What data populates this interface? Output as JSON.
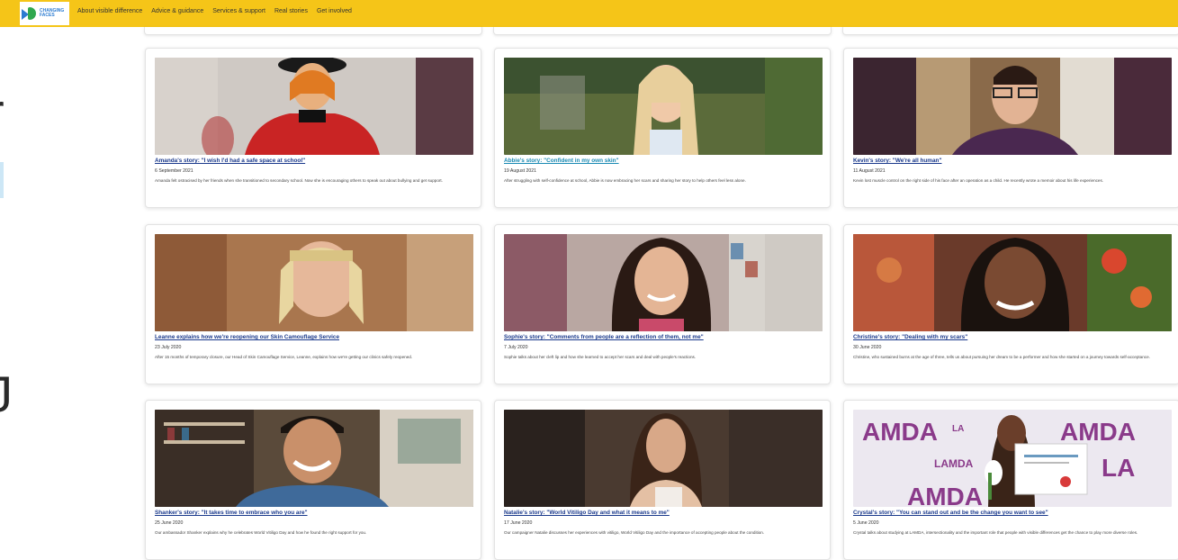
{
  "brand": {
    "logo_text": "CHANGING FACES"
  },
  "nav": [
    "About visible difference",
    "Advice & guidance",
    "Services & support",
    "Real stories",
    "Get involved"
  ],
  "colors": {
    "header": "#f5c518",
    "title_link": "#1b3a8c",
    "visited_link": "#1a8ab3"
  },
  "stories": [
    {
      "title": "Amanda's story: \"I wish I'd had a safe space at school\"",
      "date": "6 September 2021",
      "desc": "Amanda felt ostracised by her friends when she transitioned to secondary school. Now she is encouraging others to speak out about bullying and get support."
    },
    {
      "title": "Abbie's story: \"Confident in my own skin\"",
      "date": "19 August 2021",
      "desc": "After struggling with self-confidence at school, Abbie is now embracing her scars and sharing her story to help others feel less alone."
    },
    {
      "title": "Kevin's story: \"We're all human\"",
      "date": "11 August 2021",
      "desc": "Kevin lost muscle control on the right side of his face after an operation as a child. He recently wrote a memoir about his life experiences."
    },
    {
      "title": "Leanne explains how we're reopening our Skin Camouflage Service",
      "date": "23 July 2020",
      "desc": "After 15 months of temporary closure, our Head of Skin Camouflage Service, Leanne, explains how we're getting our clinics safely reopened."
    },
    {
      "title": "Sophie's story: \"Comments from people are a reflection of them, not me\"",
      "date": "7 July 2020",
      "desc": "Sophie talks about her cleft lip and how she learned to accept her scars and deal with people's reactions."
    },
    {
      "title": "Christine's story: \"Dealing with my scars\"",
      "date": "30 June 2020",
      "desc": "Christine, who sustained burns at the age of three, tells us about pursuing her dream to be a performer and how she started on a journey towards self-acceptance."
    },
    {
      "title": "Shanker's story: \"It takes time to embrace who you are\"",
      "date": "25 June 2020",
      "desc": "Our ambassador Shanker explains why he celebrates World Vitiligo Day and how he found the right support for you."
    },
    {
      "title": "Natalie's story: \"World Vitiligo Day and what it means to me\"",
      "date": "17 June 2020",
      "desc": "Our campaigner Natalie discusses her experiences with vitiligo, World Vitiligo Day and the importance of accepting people about the condition."
    },
    {
      "title": "Crystal's story: \"You can stand out and be the change you want to see\"",
      "date": "5 June 2020",
      "desc": "Crystal talks about studying at LAMDA, intersectionality and the important role that people with visible differences get the chance to play more diverse roles."
    }
  ],
  "lamda_sign": [
    "AMDA",
    "LA",
    "AMDA",
    "LAMDA",
    "LA",
    "AMDA"
  ]
}
